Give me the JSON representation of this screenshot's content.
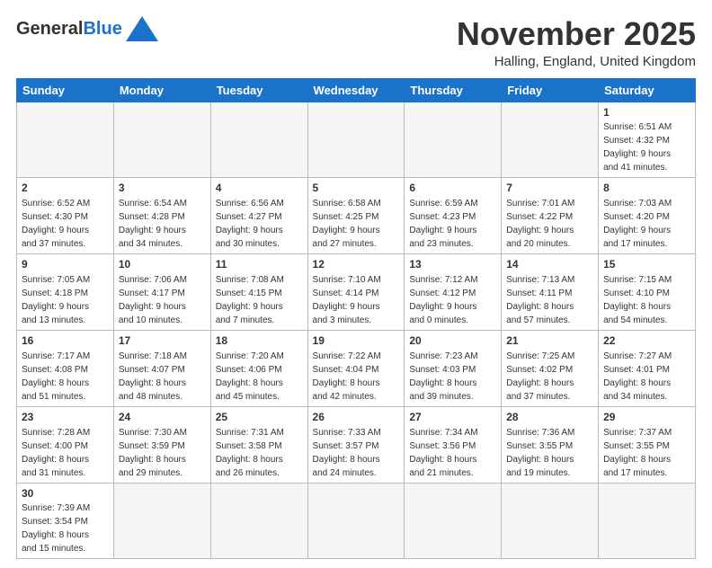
{
  "header": {
    "logo_general": "General",
    "logo_blue": "Blue",
    "month_title": "November 2025",
    "subtitle": "Halling, England, United Kingdom"
  },
  "calendar": {
    "days_of_week": [
      "Sunday",
      "Monday",
      "Tuesday",
      "Wednesday",
      "Thursday",
      "Friday",
      "Saturday"
    ],
    "weeks": [
      [
        {
          "day": "",
          "empty": true
        },
        {
          "day": "",
          "empty": true
        },
        {
          "day": "",
          "empty": true
        },
        {
          "day": "",
          "empty": true
        },
        {
          "day": "",
          "empty": true
        },
        {
          "day": "",
          "empty": true
        },
        {
          "day": "1",
          "info": "Sunrise: 6:51 AM\nSunset: 4:32 PM\nDaylight: 9 hours\nand 41 minutes."
        }
      ],
      [
        {
          "day": "2",
          "info": "Sunrise: 6:52 AM\nSunset: 4:30 PM\nDaylight: 9 hours\nand 37 minutes."
        },
        {
          "day": "3",
          "info": "Sunrise: 6:54 AM\nSunset: 4:28 PM\nDaylight: 9 hours\nand 34 minutes."
        },
        {
          "day": "4",
          "info": "Sunrise: 6:56 AM\nSunset: 4:27 PM\nDaylight: 9 hours\nand 30 minutes."
        },
        {
          "day": "5",
          "info": "Sunrise: 6:58 AM\nSunset: 4:25 PM\nDaylight: 9 hours\nand 27 minutes."
        },
        {
          "day": "6",
          "info": "Sunrise: 6:59 AM\nSunset: 4:23 PM\nDaylight: 9 hours\nand 23 minutes."
        },
        {
          "day": "7",
          "info": "Sunrise: 7:01 AM\nSunset: 4:22 PM\nDaylight: 9 hours\nand 20 minutes."
        },
        {
          "day": "8",
          "info": "Sunrise: 7:03 AM\nSunset: 4:20 PM\nDaylight: 9 hours\nand 17 minutes."
        }
      ],
      [
        {
          "day": "9",
          "info": "Sunrise: 7:05 AM\nSunset: 4:18 PM\nDaylight: 9 hours\nand 13 minutes."
        },
        {
          "day": "10",
          "info": "Sunrise: 7:06 AM\nSunset: 4:17 PM\nDaylight: 9 hours\nand 10 minutes."
        },
        {
          "day": "11",
          "info": "Sunrise: 7:08 AM\nSunset: 4:15 PM\nDaylight: 9 hours\nand 7 minutes."
        },
        {
          "day": "12",
          "info": "Sunrise: 7:10 AM\nSunset: 4:14 PM\nDaylight: 9 hours\nand 3 minutes."
        },
        {
          "day": "13",
          "info": "Sunrise: 7:12 AM\nSunset: 4:12 PM\nDaylight: 9 hours\nand 0 minutes."
        },
        {
          "day": "14",
          "info": "Sunrise: 7:13 AM\nSunset: 4:11 PM\nDaylight: 8 hours\nand 57 minutes."
        },
        {
          "day": "15",
          "info": "Sunrise: 7:15 AM\nSunset: 4:10 PM\nDaylight: 8 hours\nand 54 minutes."
        }
      ],
      [
        {
          "day": "16",
          "info": "Sunrise: 7:17 AM\nSunset: 4:08 PM\nDaylight: 8 hours\nand 51 minutes."
        },
        {
          "day": "17",
          "info": "Sunrise: 7:18 AM\nSunset: 4:07 PM\nDaylight: 8 hours\nand 48 minutes."
        },
        {
          "day": "18",
          "info": "Sunrise: 7:20 AM\nSunset: 4:06 PM\nDaylight: 8 hours\nand 45 minutes."
        },
        {
          "day": "19",
          "info": "Sunrise: 7:22 AM\nSunset: 4:04 PM\nDaylight: 8 hours\nand 42 minutes."
        },
        {
          "day": "20",
          "info": "Sunrise: 7:23 AM\nSunset: 4:03 PM\nDaylight: 8 hours\nand 39 minutes."
        },
        {
          "day": "21",
          "info": "Sunrise: 7:25 AM\nSunset: 4:02 PM\nDaylight: 8 hours\nand 37 minutes."
        },
        {
          "day": "22",
          "info": "Sunrise: 7:27 AM\nSunset: 4:01 PM\nDaylight: 8 hours\nand 34 minutes."
        }
      ],
      [
        {
          "day": "23",
          "info": "Sunrise: 7:28 AM\nSunset: 4:00 PM\nDaylight: 8 hours\nand 31 minutes."
        },
        {
          "day": "24",
          "info": "Sunrise: 7:30 AM\nSunset: 3:59 PM\nDaylight: 8 hours\nand 29 minutes."
        },
        {
          "day": "25",
          "info": "Sunrise: 7:31 AM\nSunset: 3:58 PM\nDaylight: 8 hours\nand 26 minutes."
        },
        {
          "day": "26",
          "info": "Sunrise: 7:33 AM\nSunset: 3:57 PM\nDaylight: 8 hours\nand 24 minutes."
        },
        {
          "day": "27",
          "info": "Sunrise: 7:34 AM\nSunset: 3:56 PM\nDaylight: 8 hours\nand 21 minutes."
        },
        {
          "day": "28",
          "info": "Sunrise: 7:36 AM\nSunset: 3:55 PM\nDaylight: 8 hours\nand 19 minutes."
        },
        {
          "day": "29",
          "info": "Sunrise: 7:37 AM\nSunset: 3:55 PM\nDaylight: 8 hours\nand 17 minutes."
        }
      ],
      [
        {
          "day": "30",
          "info": "Sunrise: 7:39 AM\nSunset: 3:54 PM\nDaylight: 8 hours\nand 15 minutes."
        },
        {
          "day": "",
          "empty": true
        },
        {
          "day": "",
          "empty": true
        },
        {
          "day": "",
          "empty": true
        },
        {
          "day": "",
          "empty": true
        },
        {
          "day": "",
          "empty": true
        },
        {
          "day": "",
          "empty": true
        }
      ]
    ]
  }
}
